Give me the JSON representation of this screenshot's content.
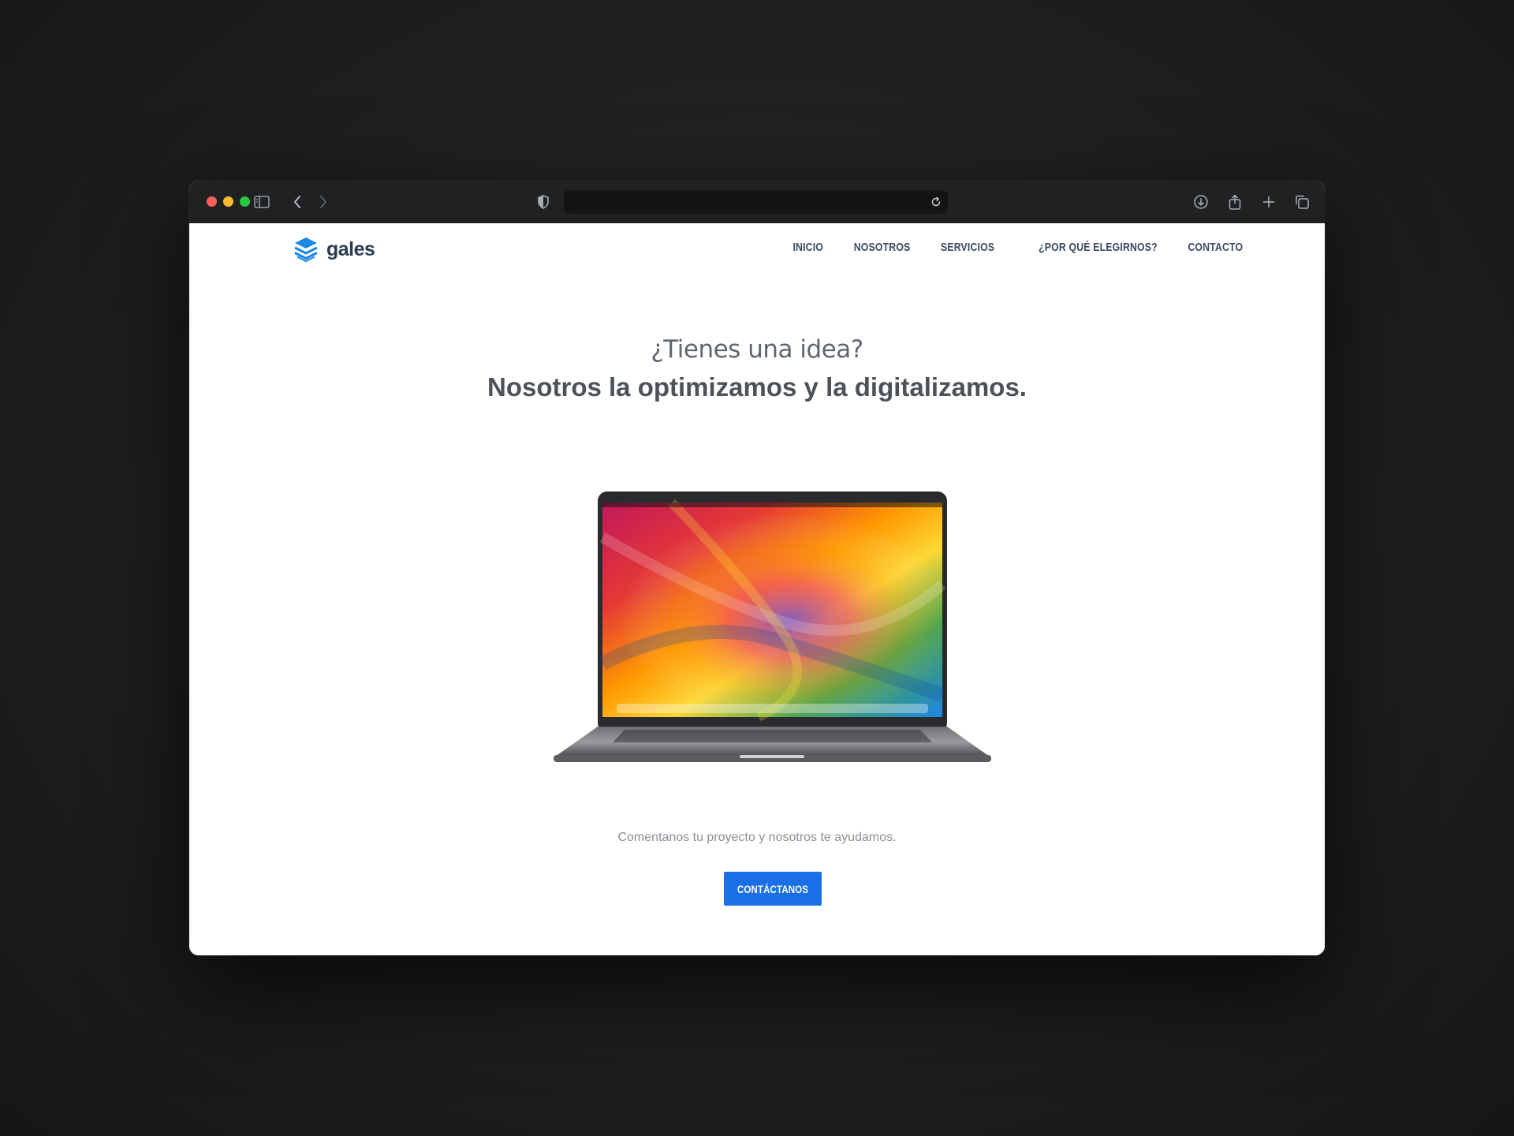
{
  "browser": {
    "address_value": "",
    "icons": [
      "sidebar-icon",
      "back-icon",
      "forward-icon",
      "shield-icon",
      "reload-icon",
      "download-icon",
      "share-icon",
      "new-tab-icon",
      "tabs-overview-icon"
    ]
  },
  "site": {
    "logo_text": "gales",
    "nav": [
      "Inicio",
      "Nosotros",
      "Servicios",
      "¿Por qué elegirnos?",
      "Contacto"
    ]
  },
  "hero": {
    "subtitle": "¿Tienes una idea?",
    "title": "Nosotros la optimizamos y la digitalizamos.",
    "cta_text": "Comentanos tu proyecto y nosotros te ayudamos.",
    "cta_button": "Contáctanos"
  },
  "colors": {
    "accent": "#1a6fe6",
    "logo_blue": "#1e88e5",
    "nav_text": "#3a4a63",
    "toolbar": "#1f2123"
  }
}
